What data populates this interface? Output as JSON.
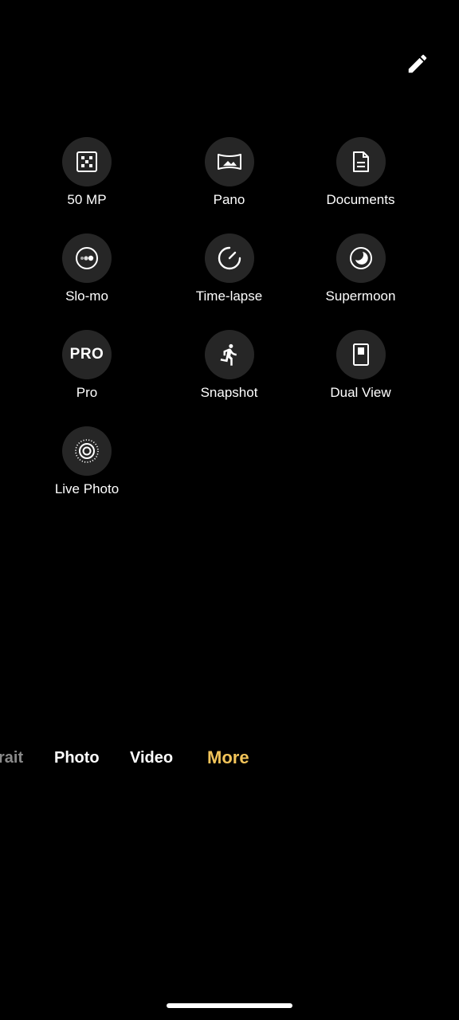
{
  "edit_button": {
    "icon": "pencil-icon"
  },
  "modes": [
    {
      "name": "mode-50mp",
      "label": "50 MP",
      "icon": "grid-dots-icon"
    },
    {
      "name": "mode-pano",
      "label": "Pano",
      "icon": "panorama-icon"
    },
    {
      "name": "mode-documents",
      "label": "Documents",
      "icon": "document-icon"
    },
    {
      "name": "mode-slo-mo",
      "label": "Slo-mo",
      "icon": "slow-motion-icon"
    },
    {
      "name": "mode-time-lapse",
      "label": "Time-lapse",
      "icon": "timer-dial-icon"
    },
    {
      "name": "mode-supermoon",
      "label": "Supermoon",
      "icon": "moon-icon"
    },
    {
      "name": "mode-pro",
      "label": "Pro",
      "icon": "pro-text-icon",
      "icon_text": "PRO"
    },
    {
      "name": "mode-snapshot",
      "label": "Snapshot",
      "icon": "running-person-icon"
    },
    {
      "name": "mode-dual-view",
      "label": "Dual View",
      "icon": "dual-view-icon"
    },
    {
      "name": "mode-live-photo",
      "label": "Live Photo",
      "icon": "live-photo-icon"
    }
  ],
  "mode_bar": {
    "tabs": [
      "rait",
      "Photo",
      "Video",
      "More"
    ],
    "active": "More",
    "active_color": "#f2c45a"
  }
}
